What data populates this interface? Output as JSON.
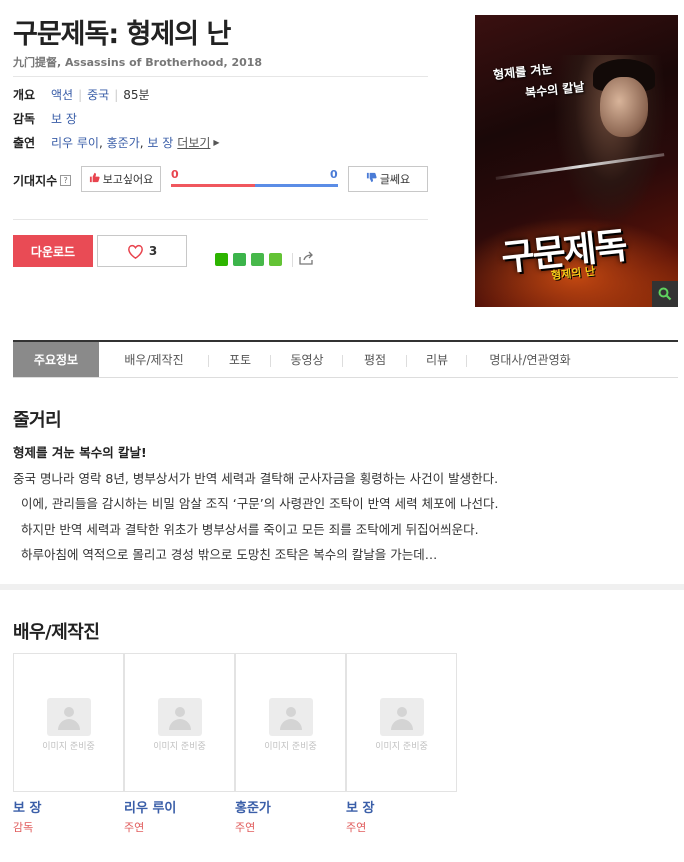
{
  "movie": {
    "title": "구문제독: 형제의 난",
    "subtitle": "九门提督, Assassins of Brotherhood, 2018"
  },
  "info": {
    "overview_label": "개요",
    "genre": "액션",
    "country": "중국",
    "runtime": "85분",
    "director_label": "감독",
    "director": "보 장",
    "cast_label": "출연",
    "cast": [
      "리우 루이",
      "홍준가",
      "보 장"
    ],
    "more": "더보기"
  },
  "expectation": {
    "label": "기대지수",
    "help_icon": "?",
    "want_label": "보고싶어요",
    "meh_label": "글쎄요",
    "want_count": "0",
    "meh_count": "0",
    "want_ratio": 0.5,
    "colors": {
      "want": "#f0575e",
      "meh": "#5b8de6"
    }
  },
  "actions": {
    "download_label": "다운로드",
    "like_count": "3"
  },
  "poster": {
    "tagline": "형제를 겨눈",
    "tagline2": "복수의 칼날",
    "title": "구문제독",
    "subtitle": "형제의 난"
  },
  "tabs": [
    "주요정보",
    "배우/제작진",
    "포토",
    "동영상",
    "평점",
    "리뷰",
    "명대사/연관영화"
  ],
  "synopsis": {
    "heading": "줄거리",
    "lead": "형제를 겨눈 복수의 칼날!",
    "lines": [
      "중국 명나라 영락 8년, 병부상서가 반역 세력과 결탁해 군사자금을 횡령하는 사건이 발생한다.",
      "  이에, 관리들을 감시하는 비밀 암살 조직 ‘구문’의 사령관인 조탁이 반역 세력 체포에 나선다.",
      "  하지만 반역 세력과 결탁한 위초가 병부상서를 죽이고 모든 죄를 조탁에게 뒤집어씌운다.",
      "  하루아침에 역적으로 몰리고 경성 밖으로 도망친 조탁은 복수의 칼날을 가는데…"
    ]
  },
  "crew": {
    "heading": "배우/제작진",
    "placeholder": "이미지 준비중",
    "people": [
      {
        "name": "보 장",
        "role": "감독"
      },
      {
        "name": "리우 루이",
        "role": "주연"
      },
      {
        "name": "홍준가",
        "role": "주연"
      },
      {
        "name": "보 장",
        "role": "주연"
      }
    ]
  }
}
